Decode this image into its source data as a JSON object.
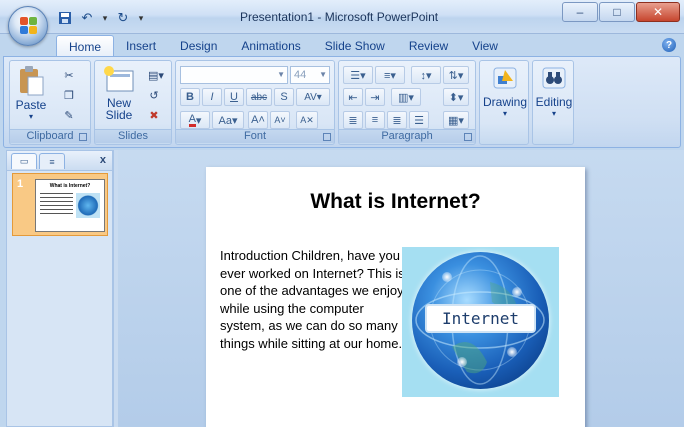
{
  "window": {
    "title": "Presentation1 - Microsoft PowerPoint",
    "controls": [
      "minimize",
      "maximize",
      "close"
    ]
  },
  "quick_access": [
    "save-icon",
    "undo-icon",
    "dropdown-arrow-icon",
    "redo-icon",
    "customize-icon"
  ],
  "ribbon": {
    "tabs": [
      {
        "label": "Home",
        "active": true
      },
      {
        "label": "Insert"
      },
      {
        "label": "Design"
      },
      {
        "label": "Animations"
      },
      {
        "label": "Slide Show"
      },
      {
        "label": "Review"
      },
      {
        "label": "View"
      }
    ],
    "groups": {
      "clipboard": {
        "label": "Clipboard",
        "paste": "Paste"
      },
      "slides": {
        "label": "Slides",
        "new_slide_line1": "New",
        "new_slide_line2": "Slide"
      },
      "font": {
        "label": "Font",
        "font_name": "",
        "font_size": "44"
      },
      "paragraph": {
        "label": "Paragraph"
      },
      "drawing": {
        "label": "Drawing"
      },
      "editing": {
        "label": "Editing"
      }
    }
  },
  "slides_panel": {
    "thumbnails": [
      {
        "number": "1",
        "title": "What is Internet?"
      }
    ]
  },
  "slide": {
    "title": "What is Internet?",
    "body": "Introduction Children, have you ever worked on Internet? This is one of the advantages we enjoy while using the computer system, as we can do so many things while sitting at our home.",
    "image_label": "Internet"
  },
  "colors": {
    "accent": "#15428b",
    "ribbon_bg": "#cfdff3",
    "selected_thumb": "#f9c985"
  }
}
